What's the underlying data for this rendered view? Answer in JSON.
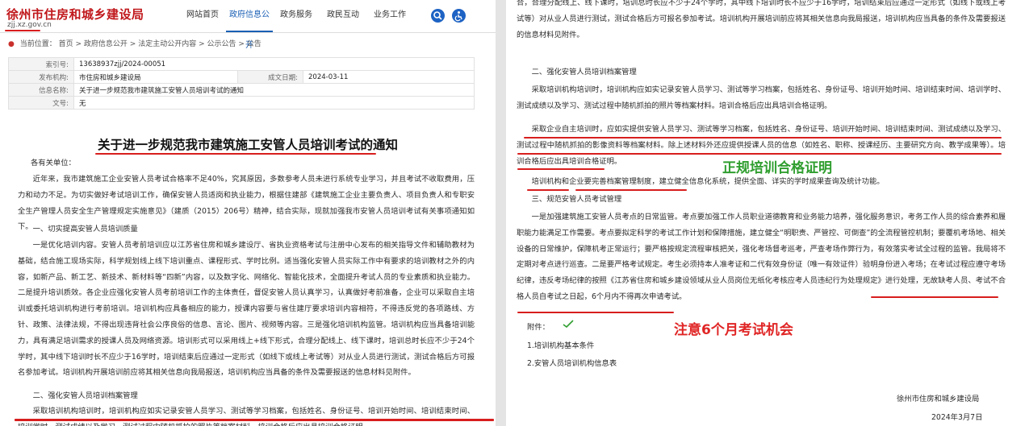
{
  "header": {
    "logo_title": "徐州市住房和城乡建设局",
    "logo_url": "zjj.xz.gov.cn",
    "nav": [
      "网站首页",
      "政府信息公开",
      "政务服务",
      "政民互动",
      "业务工作"
    ],
    "icons": [
      "search-icon",
      "accessibility-icon"
    ]
  },
  "breadcrumb": [
    "当前位置：",
    "首页",
    "政府信息公开",
    "法定主动公开内容",
    "公示公告",
    "公告"
  ],
  "info_table": {
    "index_label": "索引号:",
    "index_value": "13638937zjj/2024-00051",
    "org_label": "发布机构:",
    "org_value": "市住房和城乡建设局",
    "date_label": "成文日期:",
    "date_value": "2024-03-11",
    "name_label": "信息名称:",
    "name_value": "关于进一步规范我市建筑施工安管人员培训考试的通知",
    "docno_label": "文号:",
    "docno_value": "无"
  },
  "document": {
    "title": "关于进一步规范我市建筑施工安管人员培训考试的通知",
    "salutation": "各有关单位：",
    "intro": "近年来，我市建筑施工企业安管人员考试合格率不足40%，究其原因，多数参考人员未进行系统专业学习，并且考试不收取费用，压力和动力不足。为切实做好考试培训工作，确保安管人员适岗和执业能力，根据住建部《建筑施工企业主要负责人、项目负责人和专职安全生产管理人员安全生产管理规定实施意见》（建质（2015）206号）精神，结合实际，现就加强我市安管人员培训考试有关事项通知如下。",
    "sec1_heading": "一、切实提高安管人员培训质量",
    "sec1_body": "一是优化培训内容。安管人员考前培训应以江苏省住房和城乡建设厅、省执业资格考试与注册中心发布的相关指导文件和辅助教材为基础，结合施工现场实际，科学规划线上线下培训重点、课程形式、学时比例。适当强化安管人员实际工作中有要求的培训教材之外的内容，如新产品、新工艺、新技术、新材料等“四新”内容，以及数字化、网络化、智能化技术，全面提升考试人员的专业素质和执业能力。二是提升培训质效。各企业应强化安管人员考前培训工作的主体责任，督促安管人员认真学习，认真做好考前准备，企业可以采取自主培训或委托培训机构进行考前培训。培训机构应具备相应的能力，授课内容要与省住建厅要求培训内容相符，不得违反党的各项路线、方针、政策、法律法规，不得出现违背社会公序良俗的信息、言论、图片、视频等内容。三是强化培训机构监管。培训机构应当具备培训能力，具有满足培训需求的授课人员及网络资源。培训形式可以采用线上+线下形式，合理分配线上、线下课时，培训总时长应不少于24个学时，其中线下培训时长不应少于16学时，培训结束后应通过一定形式（如线下或线上考试等）对从业人员进行测试，测试合格后方可报名参加考试。培训机构开展培训前应将其相关信息向我局报送，培训机构应当具备的条件及需要报送的信息材料见附件。",
    "sec2_heading": "二、强化安管人员培训档案管理",
    "sec2_p1": "采取培训机构培训时，培训机构应如实记录安管人员学习、测试等学习档案，包括姓名、身份证号、培训开始时间、培训结束时间、培训学时、测试成绩以及学习、测试过程中随机抓拍的照片等档案材料。培训合格后应出具培训合格证明。",
    "sec2_p2": "采取企业自主培训时，应如实提供安管人员学习、测试等学习档案，包括姓名、身份证号、培训开始时间、培训结束时间、测试成绩以及学习、测试过程中随机抓拍的影像资料等档案材料。除上述材料外还应提供授课人员的信息（如姓名、职称、授课经历、主要研究方向、教学成果等）。培训合格后应出具培训合格证明。",
    "sec2_p3": "培训机构和企业要完善档案管理制度，建立健全信息化系统，提供全面、详实的学时成果查询及统计功能。",
    "sec3_heading": "三、规范安管人员考试管理",
    "sec3_body": "一是加强建筑施工安管人员考点的日常监管。考点要加强工作人员职业道德教育和业务能力培养，强化服务意识，考务工作人员的综合素养和履职能力能满足工作需要。考点要拟定科学的考试工作计划和保障措施，建立健全“明职责、严管控、可倒查”的全流程管控机制；要覆机考场地、相关设备的日常维护，保障机考正常运行；要严格按规定流程审核把关，强化考场督考巡考，严查考场作弊行为，有效落实考试全过程的监管。我局将不定期对考点进行巡查。二是要严格考试规定。考生必须持本人准考证和二代有效身份证（唯一有效证件）验明身份进入考场；在考试过程应遵守考场纪律，违反考场纪律的按照《江苏省住房和城乡建设领域从业人员岗位无纸化考核应考人员违纪行为处理规定》进行处理，无故缺考人员、考试不合格人员自考试之日起，6个月内不得再次申请考试。",
    "attachments_label": "附件：",
    "attachment_1": "1.培训机构基本条件",
    "attachment_2": "2.安管人员培训机构信息表",
    "signature_org": "徐州市住房和城乡建设局",
    "signature_date": "2024年3月7日"
  },
  "annotations": {
    "note_certificate": "正规培训合格证明",
    "note_exam": "注意6个月考试机会",
    "colors": {
      "underline": "#d81e1e",
      "green_text": "#2f9e2f",
      "red_text": "#e02525",
      "nav_active": "#1a5fb4"
    }
  }
}
